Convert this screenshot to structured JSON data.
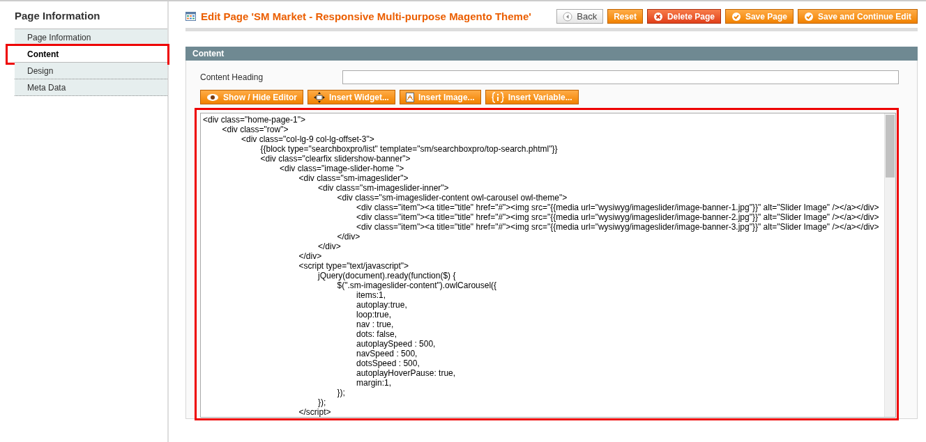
{
  "sidebar": {
    "title": "Page Information",
    "tabs": [
      {
        "label": "Page Information",
        "selected": false
      },
      {
        "label": "Content",
        "selected": true
      },
      {
        "label": "Design",
        "selected": false
      },
      {
        "label": "Meta Data",
        "selected": false
      }
    ]
  },
  "header": {
    "title": "Edit Page 'SM Market - Responsive Multi-purpose Magento Theme'",
    "buttons": [
      {
        "label": "Back",
        "kind": "back"
      },
      {
        "label": "Reset",
        "kind": "plain"
      },
      {
        "label": "Delete Page",
        "kind": "delete"
      },
      {
        "label": "Save Page",
        "kind": "save"
      },
      {
        "label": "Save and Continue Edit",
        "kind": "save"
      }
    ]
  },
  "section": {
    "title": "Content",
    "field": {
      "label": "Content Heading"
    },
    "toolbar": [
      {
        "label": "Show / Hide Editor",
        "kind": "eye"
      },
      {
        "label": "Insert Widget...",
        "kind": "widget"
      },
      {
        "label": "Insert Image...",
        "kind": "image"
      },
      {
        "label": "Insert Variable...",
        "kind": "variable"
      }
    ],
    "editor": {
      "value": "<div class=\"home-page-1\">\n\t<div class=\"row\">\n\t\t<div class=\"col-lg-9 col-lg-offset-3\">\n\t\t\t{{block type=\"searchboxpro/list\" template=\"sm/searchboxpro/top-search.phtml\"}}\n\t\t\t<div class=\"clearfix slidershow-banner\">\n\t\t\t\t<div class=\"image-slider-home \">\n\t\t\t\t\t<div class=\"sm-imageslider\">\n\t\t\t\t\t\t<div class=\"sm-imageslider-inner\">\n\t\t\t\t\t\t\t<div class=\"sm-imageslider-content owl-carousel owl-theme\">\n\t\t\t\t\t\t\t\t<div class=\"item\"><a title=\"title\" href=\"#\"><img src=\"{{media url=\"wysiwyg/imageslider/image-banner-1.jpg\"}}\" alt=\"Slider Image\" /></a></div>\n\t\t\t\t\t\t\t\t<div class=\"item\"><a title=\"title\" href=\"#\"><img src=\"{{media url=\"wysiwyg/imageslider/image-banner-2.jpg\"}}\" alt=\"Slider Image\" /></a></div>\n\t\t\t\t\t\t\t\t<div class=\"item\"><a title=\"title\" href=\"#\"><img src=\"{{media url=\"wysiwyg/imageslider/image-banner-3.jpg\"}}\" alt=\"Slider Image\" /></a></div>\n\t\t\t\t\t\t\t</div>\n\t\t\t\t\t\t</div>\n\t\t\t\t\t</div>\n\t\t\t\t\t<script type=\"text/javascript\">\n\t\t\t\t\t\tjQuery(document).ready(function($) {\n\t\t\t\t\t\t\t$(\".sm-imageslider-content\").owlCarousel({\n\t\t\t\t\t\t\t\titems:1,\n\t\t\t\t\t\t\t\tautoplay:true,\n\t\t\t\t\t\t\t\tloop:true,\n\t\t\t\t\t\t\t\tnav : true,\n\t\t\t\t\t\t\t\tdots: false,\n\t\t\t\t\t\t\t\tautoplaySpeed : 500,\n\t\t\t\t\t\t\t\tnavSpeed : 500,\n\t\t\t\t\t\t\t\tdotsSpeed : 500,\n\t\t\t\t\t\t\t\tautoplayHoverPause: true,\n\t\t\t\t\t\t\t\tmargin:1,\n\t\t\t\t\t\t\t});\n\t\t\t\t\t\t});\n\t\t\t\t\t</script>"
    }
  }
}
